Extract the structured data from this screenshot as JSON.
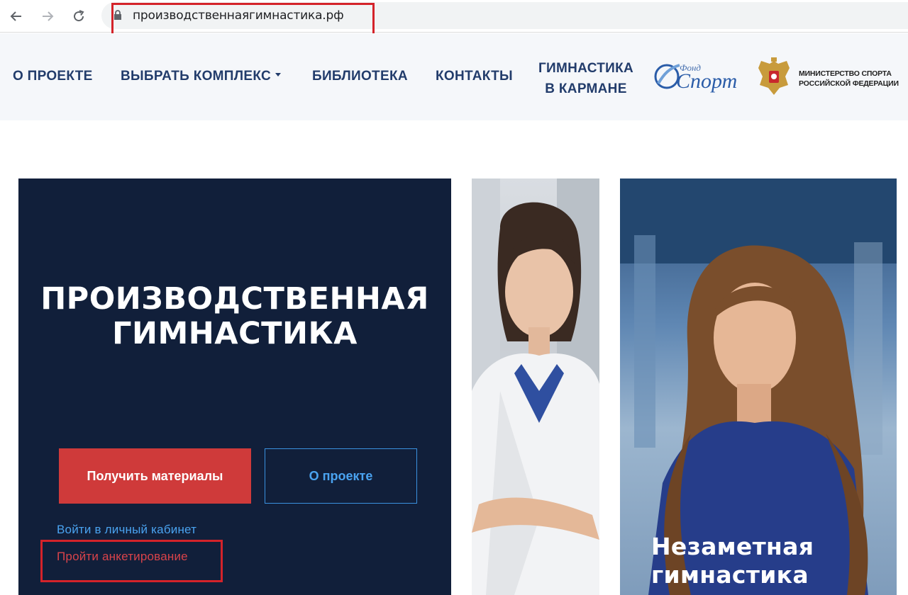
{
  "browser": {
    "url": "производственнаягимнастика.рф"
  },
  "header": {
    "menu": {
      "about": "О ПРОЕКТЕ",
      "choose": "ВЫБРАТЬ КОМПЛЕКС",
      "library": "БИБЛИОТЕКА",
      "contacts": "КОНТАКТЫ",
      "pocket_line1": "ГИМНАСТИКА",
      "pocket_line2": "В КАРМАНЕ"
    },
    "fond_logo": {
      "top": "Фонд",
      "main": "Спорт"
    },
    "ministry": {
      "line1": "МИНИСТЕРСТВО СПОРТА",
      "line2": "РОССИЙСКОЙ ФЕДЕРАЦИИ"
    }
  },
  "hero": {
    "title_line1": "ПРОИЗВОДСТВЕННАЯ",
    "title_line2": "ГИМНАСТИКА",
    "primary_button": "Получить материалы",
    "secondary_button": "О проекте",
    "cabinet_link": "Войти в личный кабинет",
    "survey_link": "Пройти анкетирование"
  },
  "cards": {
    "card2_caption_line1": "Незаметная",
    "card2_caption_line2": "гимнастика"
  },
  "colors": {
    "hero_bg": "#111f3a",
    "accent_red": "#cf3a3a",
    "link_blue": "#4aa3f0",
    "nav_text": "#223c6b",
    "annotation_red": "#d4232a"
  }
}
